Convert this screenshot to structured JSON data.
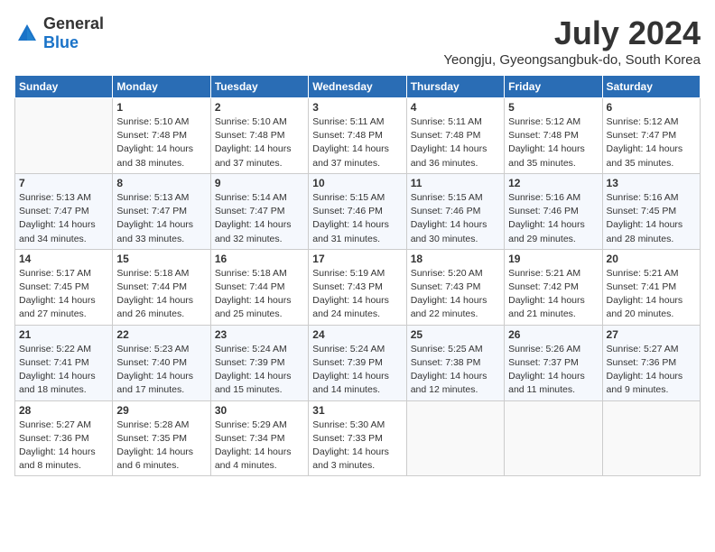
{
  "logo": {
    "general": "General",
    "blue": "Blue"
  },
  "header": {
    "title": "July 2024",
    "subtitle": "Yeongju, Gyeongsangbuk-do, South Korea"
  },
  "weekdays": [
    "Sunday",
    "Monday",
    "Tuesday",
    "Wednesday",
    "Thursday",
    "Friday",
    "Saturday"
  ],
  "weeks": [
    [
      {
        "day": "",
        "info": ""
      },
      {
        "day": "1",
        "info": "Sunrise: 5:10 AM\nSunset: 7:48 PM\nDaylight: 14 hours\nand 38 minutes."
      },
      {
        "day": "2",
        "info": "Sunrise: 5:10 AM\nSunset: 7:48 PM\nDaylight: 14 hours\nand 37 minutes."
      },
      {
        "day": "3",
        "info": "Sunrise: 5:11 AM\nSunset: 7:48 PM\nDaylight: 14 hours\nand 37 minutes."
      },
      {
        "day": "4",
        "info": "Sunrise: 5:11 AM\nSunset: 7:48 PM\nDaylight: 14 hours\nand 36 minutes."
      },
      {
        "day": "5",
        "info": "Sunrise: 5:12 AM\nSunset: 7:48 PM\nDaylight: 14 hours\nand 35 minutes."
      },
      {
        "day": "6",
        "info": "Sunrise: 5:12 AM\nSunset: 7:47 PM\nDaylight: 14 hours\nand 35 minutes."
      }
    ],
    [
      {
        "day": "7",
        "info": "Sunrise: 5:13 AM\nSunset: 7:47 PM\nDaylight: 14 hours\nand 34 minutes."
      },
      {
        "day": "8",
        "info": "Sunrise: 5:13 AM\nSunset: 7:47 PM\nDaylight: 14 hours\nand 33 minutes."
      },
      {
        "day": "9",
        "info": "Sunrise: 5:14 AM\nSunset: 7:47 PM\nDaylight: 14 hours\nand 32 minutes."
      },
      {
        "day": "10",
        "info": "Sunrise: 5:15 AM\nSunset: 7:46 PM\nDaylight: 14 hours\nand 31 minutes."
      },
      {
        "day": "11",
        "info": "Sunrise: 5:15 AM\nSunset: 7:46 PM\nDaylight: 14 hours\nand 30 minutes."
      },
      {
        "day": "12",
        "info": "Sunrise: 5:16 AM\nSunset: 7:46 PM\nDaylight: 14 hours\nand 29 minutes."
      },
      {
        "day": "13",
        "info": "Sunrise: 5:16 AM\nSunset: 7:45 PM\nDaylight: 14 hours\nand 28 minutes."
      }
    ],
    [
      {
        "day": "14",
        "info": "Sunrise: 5:17 AM\nSunset: 7:45 PM\nDaylight: 14 hours\nand 27 minutes."
      },
      {
        "day": "15",
        "info": "Sunrise: 5:18 AM\nSunset: 7:44 PM\nDaylight: 14 hours\nand 26 minutes."
      },
      {
        "day": "16",
        "info": "Sunrise: 5:18 AM\nSunset: 7:44 PM\nDaylight: 14 hours\nand 25 minutes."
      },
      {
        "day": "17",
        "info": "Sunrise: 5:19 AM\nSunset: 7:43 PM\nDaylight: 14 hours\nand 24 minutes."
      },
      {
        "day": "18",
        "info": "Sunrise: 5:20 AM\nSunset: 7:43 PM\nDaylight: 14 hours\nand 22 minutes."
      },
      {
        "day": "19",
        "info": "Sunrise: 5:21 AM\nSunset: 7:42 PM\nDaylight: 14 hours\nand 21 minutes."
      },
      {
        "day": "20",
        "info": "Sunrise: 5:21 AM\nSunset: 7:41 PM\nDaylight: 14 hours\nand 20 minutes."
      }
    ],
    [
      {
        "day": "21",
        "info": "Sunrise: 5:22 AM\nSunset: 7:41 PM\nDaylight: 14 hours\nand 18 minutes."
      },
      {
        "day": "22",
        "info": "Sunrise: 5:23 AM\nSunset: 7:40 PM\nDaylight: 14 hours\nand 17 minutes."
      },
      {
        "day": "23",
        "info": "Sunrise: 5:24 AM\nSunset: 7:39 PM\nDaylight: 14 hours\nand 15 minutes."
      },
      {
        "day": "24",
        "info": "Sunrise: 5:24 AM\nSunset: 7:39 PM\nDaylight: 14 hours\nand 14 minutes."
      },
      {
        "day": "25",
        "info": "Sunrise: 5:25 AM\nSunset: 7:38 PM\nDaylight: 14 hours\nand 12 minutes."
      },
      {
        "day": "26",
        "info": "Sunrise: 5:26 AM\nSunset: 7:37 PM\nDaylight: 14 hours\nand 11 minutes."
      },
      {
        "day": "27",
        "info": "Sunrise: 5:27 AM\nSunset: 7:36 PM\nDaylight: 14 hours\nand 9 minutes."
      }
    ],
    [
      {
        "day": "28",
        "info": "Sunrise: 5:27 AM\nSunset: 7:36 PM\nDaylight: 14 hours\nand 8 minutes."
      },
      {
        "day": "29",
        "info": "Sunrise: 5:28 AM\nSunset: 7:35 PM\nDaylight: 14 hours\nand 6 minutes."
      },
      {
        "day": "30",
        "info": "Sunrise: 5:29 AM\nSunset: 7:34 PM\nDaylight: 14 hours\nand 4 minutes."
      },
      {
        "day": "31",
        "info": "Sunrise: 5:30 AM\nSunset: 7:33 PM\nDaylight: 14 hours\nand 3 minutes."
      },
      {
        "day": "",
        "info": ""
      },
      {
        "day": "",
        "info": ""
      },
      {
        "day": "",
        "info": ""
      }
    ]
  ]
}
